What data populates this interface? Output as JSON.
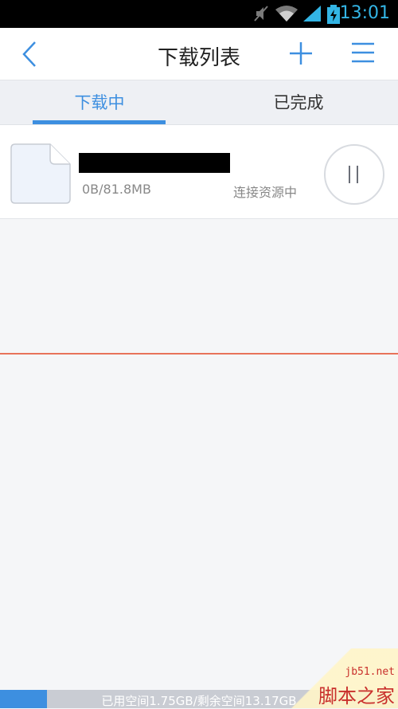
{
  "status_bar": {
    "time": "13:01",
    "icons": [
      "mute-icon",
      "wifi-icon",
      "signal-icon",
      "battery-charging-icon"
    ],
    "accent_color": "#33b5e5"
  },
  "nav": {
    "title": "下载列表",
    "back_icon": "back-arrow-icon",
    "add_icon": "plus-icon",
    "menu_icon": "menu-icon",
    "accent_color": "#3d8fe0"
  },
  "tabs": [
    {
      "label": "下载中",
      "active": true
    },
    {
      "label": "已完成",
      "active": false
    }
  ],
  "downloads": [
    {
      "name": "",
      "size": "0B/81.8MB",
      "status": "连接资源中",
      "action_icon": "pause-icon"
    }
  ],
  "storage": {
    "text": "已用空间1.75GB/剩余空间13.17GB",
    "used_fraction": 0.117
  },
  "watermark": {
    "site": "jb51.net",
    "name": "脚本之家"
  }
}
